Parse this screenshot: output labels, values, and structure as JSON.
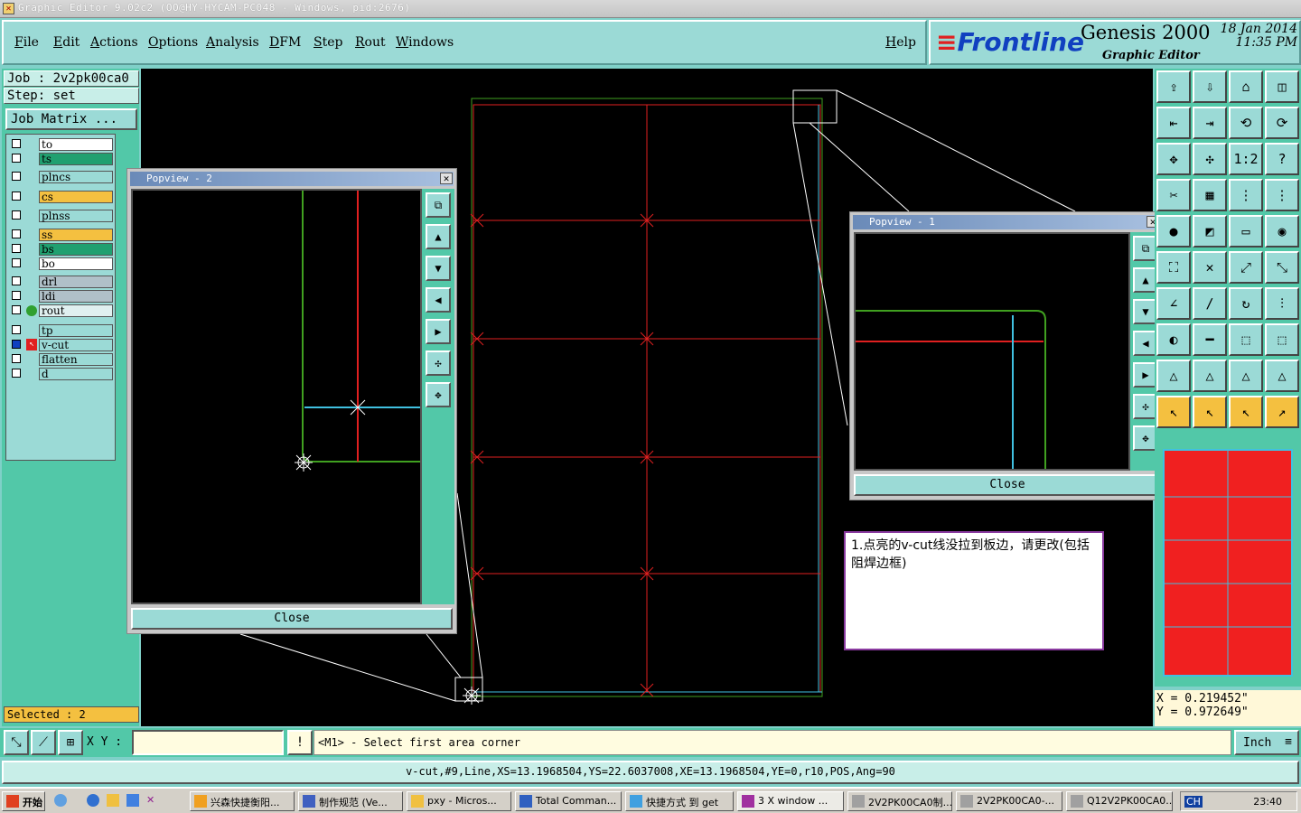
{
  "window": {
    "title": "Graphic Editor 9.02c2 (OO@HY-HYCAM-PC048 - Windows, pid:2676)"
  },
  "menu": [
    "File",
    "Edit",
    "Actions",
    "Options",
    "Analysis",
    "DFM",
    "Step",
    "Rout",
    "Windows"
  ],
  "help_label": "Help",
  "brand": {
    "logo": "Frontline",
    "product": "Genesis 2000",
    "subtitle": "Graphic Editor",
    "date": "18 Jan 2014",
    "time": "11:35 PM"
  },
  "job": {
    "job_label": "Job : 2v2pk00ca0",
    "step_label": "Step: set",
    "matrix_button": "Job Matrix ..."
  },
  "layers": [
    {
      "name": "to",
      "color": "#ffffff"
    },
    {
      "name": "ts",
      "color": "#20a070"
    },
    {
      "name": "plncs",
      "color": "#9bdad6"
    },
    {
      "name": "cs",
      "color": "#f4c040"
    },
    {
      "name": "plnss",
      "color": "#9bdad6"
    },
    {
      "name": "ss",
      "color": "#f4c040"
    },
    {
      "name": "bs",
      "color": "#20a070"
    },
    {
      "name": "bo",
      "color": "#ffffff"
    },
    {
      "name": "drl",
      "color": "#b0c0c8"
    },
    {
      "name": "ldi",
      "color": "#b0c0c8"
    },
    {
      "name": "rout",
      "color": "#e0f0f0"
    },
    {
      "name": "tp",
      "color": "#9bdad6"
    },
    {
      "name": "v-cut",
      "color": "#9bdad6"
    },
    {
      "name": "flatten",
      "color": "#9bdad6"
    },
    {
      "name": "d",
      "color": "#9bdad6"
    }
  ],
  "selected_label": "Selected : 2",
  "popview2": {
    "title": "Popview - 2",
    "close_label": "Close"
  },
  "popview1": {
    "title": "Popview - 1",
    "close_label": "Close"
  },
  "note": {
    "text": "1.点亮的v-cut线没拉到板边，请更改(包括阻焊边框)"
  },
  "coords": {
    "x": "X = 0.219452\"",
    "y": "Y = 0.972649\""
  },
  "command": {
    "xy_label": "X Y :",
    "xy_value": "",
    "message": "<M1> - Select first area corner",
    "unit": "Inch"
  },
  "status_text": "v-cut,#9,Line,XS=13.1968504,YS=22.6037008,XE=13.1968504,YE=0,r10,POS,Ang=90",
  "taskbar": {
    "start": "开始",
    "tasks": [
      "兴森快捷衡阳...",
      "制作规范 (Ve...",
      "pxy - Micros...",
      "Total Comman...",
      "快捷方式 到 get",
      "3 X window ...",
      "2V2PK00CA0制...",
      "2V2PK00CA0-...",
      "Q12V2PK00CA0..."
    ],
    "clock": "23:40",
    "lang": "CH"
  },
  "colors": {
    "accent": "#52c8a8",
    "panel": "#9bdad6",
    "canvas": "#000000",
    "red_line": "#e02020",
    "green_line": "#40a020",
    "cyan_line": "#40c0e0"
  }
}
